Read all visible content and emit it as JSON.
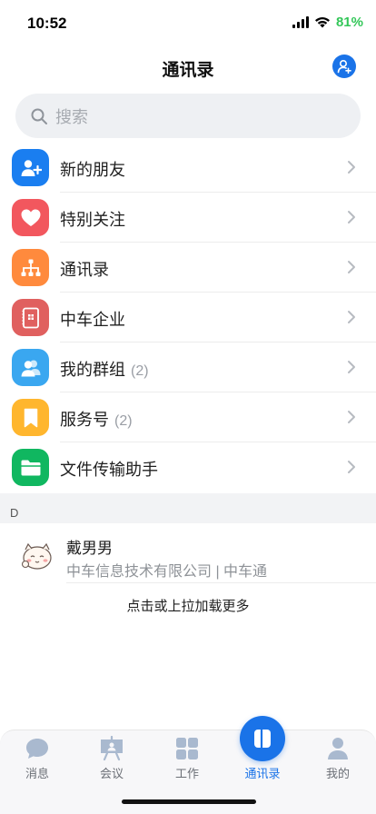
{
  "status_bar": {
    "time": "10:52",
    "battery": "81%"
  },
  "header": {
    "title": "通讯录"
  },
  "search": {
    "placeholder": "搜索"
  },
  "menu": [
    {
      "label": "新的朋友",
      "count": "",
      "color": "#1a7ef0",
      "icon": "add-friend-icon"
    },
    {
      "label": "特别关注",
      "count": "",
      "color": "#f2575e",
      "icon": "heart-icon"
    },
    {
      "label": "通讯录",
      "count": "",
      "color": "#ff8a3d",
      "icon": "org-chart-icon"
    },
    {
      "label": "中车企业",
      "count": "",
      "color": "#e0605f",
      "icon": "enterprise-icon"
    },
    {
      "label": "我的群组",
      "count": "(2)",
      "color": "#3aa7f0",
      "icon": "group-icon"
    },
    {
      "label": "服务号",
      "count": "(2)",
      "color": "#ffb62e",
      "icon": "bookmark-icon"
    },
    {
      "label": "文件传输助手",
      "count": "",
      "color": "#10b760",
      "icon": "folder-icon"
    }
  ],
  "section": {
    "letter": "D"
  },
  "contact": {
    "name": "戴男男",
    "subtitle": "中车信息技术有限公司 | 中车通"
  },
  "load_more": "点击或上拉加载更多",
  "tabs": [
    {
      "label": "消息",
      "icon": "message-icon"
    },
    {
      "label": "会议",
      "icon": "meeting-icon"
    },
    {
      "label": "工作",
      "icon": "work-icon"
    },
    {
      "label": "通讯录",
      "icon": "contacts-icon",
      "active": true
    },
    {
      "label": "我的",
      "icon": "profile-icon"
    }
  ],
  "colors": {
    "accent": "#1a73e8",
    "battery": "#34c759"
  }
}
